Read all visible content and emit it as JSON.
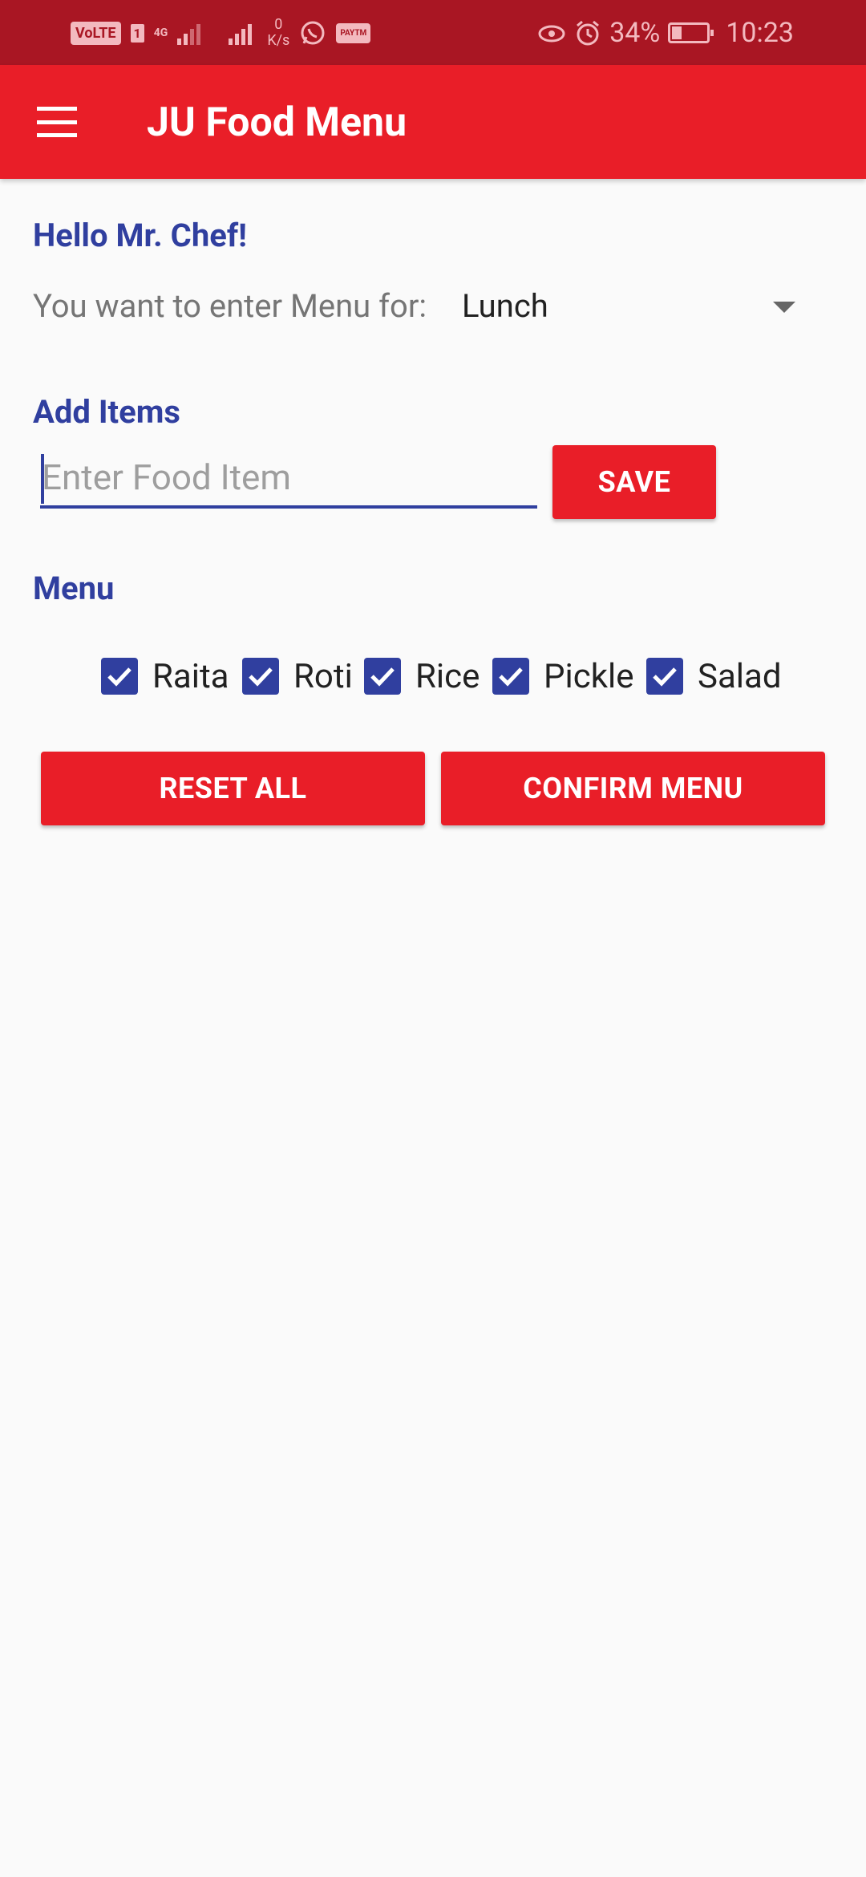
{
  "status_bar": {
    "volte": "VoLTE",
    "sim": "1",
    "network": "4G",
    "speed_value": "0",
    "speed_unit": "K/s",
    "paytm": "PAYTM",
    "battery": "34%",
    "time": "10:23"
  },
  "app_bar": {
    "title": "JU Food Menu"
  },
  "greeting": "Hello Mr. Chef!",
  "meal": {
    "label": "You want to enter Menu for:",
    "selected": "Lunch"
  },
  "add_items": {
    "heading": "Add Items",
    "placeholder": "Enter Food Item",
    "value": "",
    "save_label": "SAVE"
  },
  "menu": {
    "heading": "Menu",
    "items": [
      {
        "label": "Raita",
        "checked": true
      },
      {
        "label": "Roti",
        "checked": true
      },
      {
        "label": "Rice",
        "checked": true
      },
      {
        "label": "Pickle",
        "checked": true
      },
      {
        "label": "Salad",
        "checked": true
      }
    ]
  },
  "actions": {
    "reset_label": "RESET ALL",
    "confirm_label": "CONFIRM MENU"
  },
  "colors": {
    "primary": "#e91e28",
    "status_bar": "#a91623",
    "accent": "#303f9f"
  }
}
